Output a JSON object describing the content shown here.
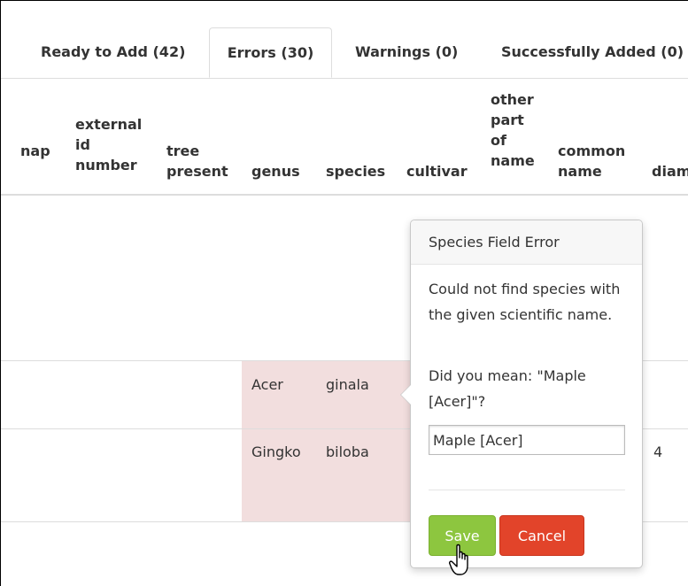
{
  "tabs": [
    {
      "label": "Ready to Add (42)"
    },
    {
      "label": "Errors (30)"
    },
    {
      "label": "Warnings (0)"
    },
    {
      "label": "Successfully Added (0)"
    }
  ],
  "columns": [
    {
      "label": "nap"
    },
    {
      "label": "external\nid\nnumber"
    },
    {
      "label": "tree\npresent"
    },
    {
      "label": "genus"
    },
    {
      "label": "species"
    },
    {
      "label": "cultivar"
    },
    {
      "label": "other\npart\nof\nname"
    },
    {
      "label": "common\nname"
    },
    {
      "label": "diam"
    }
  ],
  "rows": [
    {
      "genus": "Acer",
      "species": "ginala"
    },
    {
      "genus": "Gingko",
      "species": "biloba",
      "diameter": "4"
    }
  ],
  "popover": {
    "title": "Species Field Error",
    "message": "Could not find species with the given scientific name.",
    "suggestion": "Did you mean: \"Maple [Acer]\"?",
    "input_value": "Maple [Acer]",
    "save_label": "Save",
    "cancel_label": "Cancel"
  },
  "colors": {
    "error_cell": "#f2dede",
    "save_button": "#8dc63f",
    "cancel_button": "#e2442a"
  }
}
